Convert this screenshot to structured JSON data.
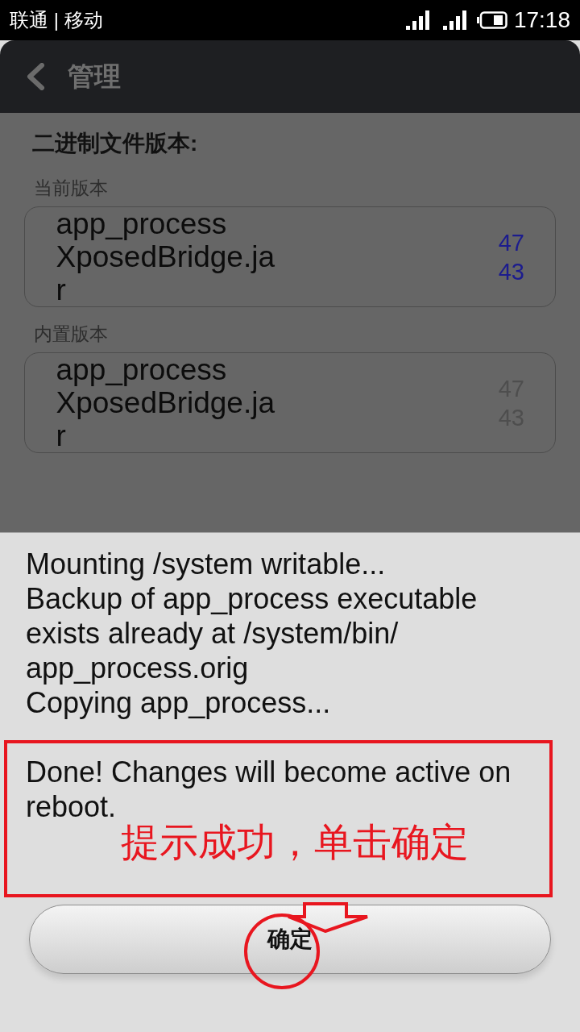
{
  "status_bar": {
    "carrier": "联通 | 移动",
    "time": "17:18"
  },
  "header": {
    "title": "管理"
  },
  "binary_versions": {
    "heading": "二进制文件版本:",
    "sections": [
      {
        "label": "当前版本",
        "files": [
          {
            "name": "app_process",
            "version": "47",
            "color": "#1c1c8e"
          },
          {
            "name": "XposedBridge.jar",
            "version": "43",
            "color": "#1c1c8e"
          }
        ]
      },
      {
        "label": "内置版本",
        "files": [
          {
            "name": "app_process",
            "version": "47",
            "color": "#4e4e4e"
          },
          {
            "name": "XposedBridge.jar",
            "version": "43",
            "color": "#4e4e4e"
          }
        ]
      }
    ]
  },
  "dialog": {
    "log": [
      "Mounting /system writable...",
      "Backup of app_process executable exists already at /system/bin/app_process.orig",
      "Copying app_process..."
    ],
    "result": "Done! Changes will become active on reboot.",
    "annotation_note": "提示成功，单击确定",
    "button": "确定"
  }
}
